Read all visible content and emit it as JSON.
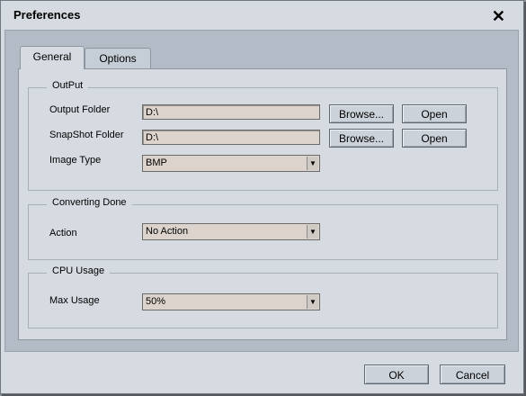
{
  "window": {
    "title": "Preferences",
    "close_glyph": "✕"
  },
  "tabs": [
    {
      "label": "General",
      "active": true
    },
    {
      "label": "Options",
      "active": false
    }
  ],
  "output": {
    "legend": "OutPut",
    "output_folder_label": "Output Folder",
    "output_folder_value": "D:\\",
    "snapshot_folder_label": "SnapShot Folder",
    "snapshot_folder_value": "D:\\",
    "image_type_label": "Image Type",
    "image_type_value": "BMP",
    "browse_label": "Browse...",
    "open_label": "Open"
  },
  "converting": {
    "legend": "Converting Done",
    "action_label": "Action",
    "action_value": "No Action"
  },
  "cpu": {
    "legend": "CPU Usage",
    "max_usage_label": "Max Usage",
    "max_usage_value": "50%"
  },
  "footer": {
    "ok_label": "OK",
    "cancel_label": "Cancel"
  },
  "icons": {
    "close": "close-icon",
    "dropdown": "chevron-down-icon"
  }
}
